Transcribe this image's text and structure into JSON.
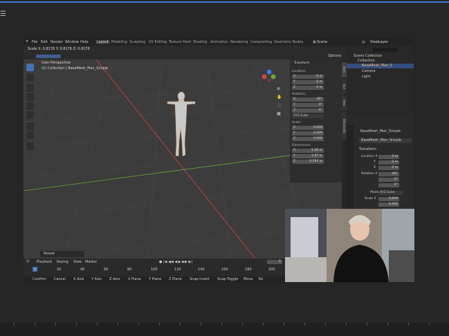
{
  "outer": {
    "menu_icon": "hamburger-icon"
  },
  "topbar": {
    "menus": [
      "File",
      "Edit",
      "Render",
      "Window",
      "Help"
    ],
    "workspaces": [
      "Layout",
      "Modeling",
      "Sculpting",
      "UV Editing",
      "Texture Paint",
      "Shading",
      "Animation",
      "Rendering",
      "Compositing",
      "Geometry Nodes"
    ],
    "active_workspace": "Layout",
    "scene": "Scene",
    "view_layer": "ViewLayer"
  },
  "viewport_header": {
    "scale_readout": "Scale X: 0.8176   Y: 0.8176   Z: 0.8176",
    "options": "Options"
  },
  "viewport": {
    "perspective": "User Perspective",
    "collection": "(1) Collection | BaseMesh_Man_Simple",
    "operator": "Resize"
  },
  "npanel": {
    "section": "Transform",
    "location_label": "Location:",
    "location": {
      "x": "0 m",
      "y": "0 m",
      "z": "0 m"
    },
    "rotation_label": "Rotation:",
    "rotation": {
      "x": "90°",
      "y": "0°",
      "z": "0°"
    },
    "rotation_mode": "XYZ Euler",
    "scale_label": "Scale:",
    "scale": {
      "x": "0.009",
      "y": "0.009",
      "z": "0.009"
    },
    "dimensions_label": "Dimensions:",
    "dimensions": {
      "x": "1.66 m",
      "y": "1.67 m",
      "z": "0.292 m"
    },
    "tabs": [
      "Item",
      "Tool",
      "View",
      "BlenderKit"
    ]
  },
  "outliner": {
    "root": "Scene Collection",
    "items": [
      "Collection",
      "BaseMesh_Man_S",
      "Camera",
      "Light"
    ]
  },
  "properties": {
    "object_name": "BaseMesh_Man_Simple",
    "object_field": "BaseMesh_Man_Simple",
    "section": "Transform",
    "location_x": "Location X",
    "location_x_val": "0 m",
    "y": "Y",
    "loc_y_val": "0 m",
    "z": "Z",
    "loc_z_val": "0 m",
    "rotation_x": "Rotation X",
    "rot_x_val": "90°",
    "rot_y_val": "0°",
    "rot_z_val": "0°",
    "mode_label": "Mode",
    "mode": "XYZ Euler",
    "scale_x": "Scale X",
    "scale_x_val": "0.009",
    "scale_y_val": "0.009"
  },
  "timeline": {
    "menus": [
      "Playback",
      "Keying",
      "View",
      "Marker"
    ],
    "ticks": [
      "0",
      "20",
      "40",
      "60",
      "80",
      "100",
      "120",
      "140",
      "160",
      "180",
      "200"
    ],
    "current_frame": "1"
  },
  "statusbar": {
    "items": [
      "Confirm",
      "Cancel",
      "X Axis",
      "Y Axis",
      "Z Axis",
      "X Plane",
      "Y Plane",
      "Z Plane",
      "Snap Invert",
      "Snap Toggle",
      "Move",
      "Ro"
    ]
  },
  "colors": {
    "accent": "#4772b3",
    "x_axis": "#d24545",
    "y_axis": "#6aa53a",
    "z_axis": "#3b7be0"
  }
}
